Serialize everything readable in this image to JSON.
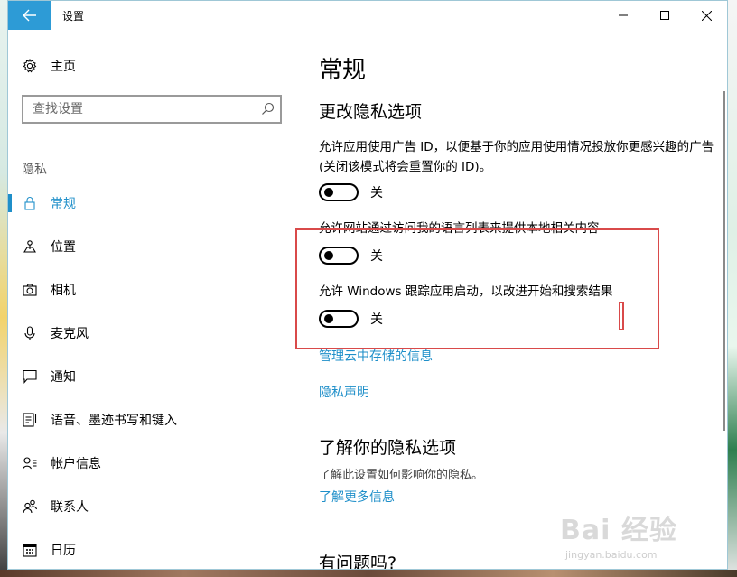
{
  "window": {
    "title": "设置"
  },
  "sidebar": {
    "home_label": "主页",
    "search_placeholder": "查找设置",
    "section_label": "隐私",
    "items": [
      {
        "label": "常规",
        "icon": "lock-icon",
        "active": true
      },
      {
        "label": "位置",
        "icon": "location-icon"
      },
      {
        "label": "相机",
        "icon": "camera-icon"
      },
      {
        "label": "麦克风",
        "icon": "microphone-icon"
      },
      {
        "label": "通知",
        "icon": "notification-icon"
      },
      {
        "label": "语音、墨迹书写和键入",
        "icon": "speech-icon"
      },
      {
        "label": "帐户信息",
        "icon": "account-icon"
      },
      {
        "label": "联系人",
        "icon": "contacts-icon"
      },
      {
        "label": "日历",
        "icon": "calendar-icon"
      }
    ]
  },
  "main": {
    "page_title": "常规",
    "section1_title": "更改隐私选项",
    "option1_text": "允许应用使用广告 ID，以便基于你的应用使用情况投放你更感兴趣的广告(关闭该模式将会重置你的 ID)。",
    "option1_state": "关",
    "option2_text": "允许网站通过访问我的语言列表来提供本地相关内容",
    "option2_state": "关",
    "option3_text": "允许 Windows 跟踪应用启动，以改进开始和搜索结果",
    "option3_state": "关",
    "link_cloud": "管理云中存储的信息",
    "link_privacy_statement": "隐私声明",
    "section2_title": "了解你的隐私选项",
    "section2_desc": "了解此设置如何影响你的隐私。",
    "link_learn_more": "了解更多信息",
    "section3_title": "有问题吗?"
  },
  "watermark": {
    "main": "Bai 经验",
    "sub": "jingyan.baidu.com"
  },
  "colors": {
    "accent": "#1f8fc9",
    "back_button": "#2d9bd6",
    "highlight": "#d94a4a"
  }
}
